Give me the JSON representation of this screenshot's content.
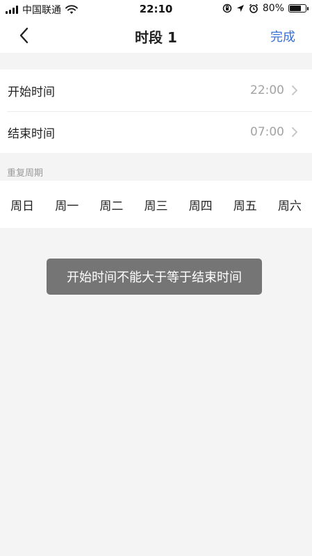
{
  "status_bar": {
    "carrier": "中国联通",
    "time": "22:10",
    "battery_percent": "80%",
    "battery_level": 0.8
  },
  "nav": {
    "title": "时段 1",
    "done_label": "完成"
  },
  "time_rows": [
    {
      "label": "开始时间",
      "value": "22:00"
    },
    {
      "label": "结束时间",
      "value": "07:00"
    }
  ],
  "repeat": {
    "section_label": "重复周期",
    "weekdays": [
      "周日",
      "周一",
      "周二",
      "周三",
      "周四",
      "周五",
      "周六"
    ]
  },
  "toast": {
    "message": "开始时间不能大于等于结束时间"
  },
  "colors": {
    "accent": "#3a6fd8",
    "background": "#f4f4f4",
    "secondary_text": "#a3a3a3",
    "toast_bg": "#6e6e6e"
  }
}
